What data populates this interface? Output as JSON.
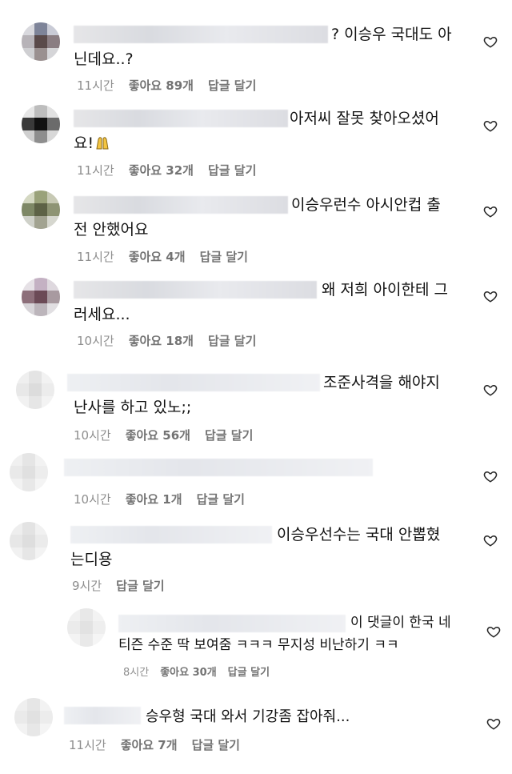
{
  "comments": [
    {
      "text_line1": "? 이승우 국대도 아",
      "text_line2": "닌데요..?",
      "time": "11시간",
      "likes": "좋아요 89개",
      "reply": "답글 달기",
      "avatar_colors": [
        "#d9d9de",
        "#7e8499",
        "#c9cbd6",
        "#b7b3b8",
        "#5a4a4a",
        "#8a7d82",
        "#cfcfd2",
        "#9a9090",
        "#d5d5d8"
      ]
    },
    {
      "text_line1": "아저씨 잘못 찾아오셨어",
      "text_line2": "요!",
      "emoji": "folded-hands",
      "time": "11시간",
      "likes": "좋아요 32개",
      "reply": "답글 달기",
      "avatar_colors": [
        "#e6e6e6",
        "#bdbdbd",
        "#e1e1e1",
        "#3a3a3a",
        "#111111",
        "#6b6b6b",
        "#cfcfcf",
        "#8e8e8e",
        "#d8d8d8"
      ]
    },
    {
      "text_line1": "이승우런수 아시안컵 출",
      "text_line2": "전 안했어요",
      "time": "11시간",
      "likes": "좋아요 4개",
      "reply": "답글 달기",
      "avatar_colors": [
        "#d4d8c2",
        "#9aa27a",
        "#c7c9b4",
        "#7e8866",
        "#5d6246",
        "#8e9474",
        "#cfd1c9",
        "#a2a391",
        "#d6d7cf"
      ]
    },
    {
      "text_line1": "왜 저희 아이한테 그",
      "text_line2": "러세요...",
      "time": "10시간",
      "likes": "좋아요 18개",
      "reply": "답글 달기",
      "avatar_colors": [
        "#e6e1e6",
        "#c4b1c3",
        "#ded8de",
        "#8d6f7a",
        "#6b4a56",
        "#a89aa0",
        "#d7d4d8",
        "#bcb5bb",
        "#e1dfe2"
      ]
    },
    {
      "text_line1": "조준사격을 해야지",
      "text_line2": "난사를 하고 있노;;",
      "time": "10시간",
      "likes": "좋아요 56개",
      "reply": "답글 달기",
      "avatar_colors": [
        "#efefef",
        "#e4e4e4",
        "#f2f2f2",
        "#e8e8e8",
        "#dcdcdc",
        "#ececec",
        "#f1f1f1",
        "#e6e6e6",
        "#f3f3f3"
      ]
    },
    {
      "text_line1": "",
      "time": "10시간",
      "likes": "좋아요 1개",
      "reply": "답글 달기",
      "avatar_colors": [
        "#f0f0f0",
        "#e5e5e5",
        "#f2f2f2",
        "#e9e9e9",
        "#e0e0e0",
        "#ededed",
        "#f2f2f2",
        "#e8e8e8",
        "#f4f4f4"
      ]
    },
    {
      "text_line1": "이승우선수는 국대 안뽑혔",
      "text_line2": "는디용",
      "time": "9시간",
      "reply": "답글 달기",
      "avatar_colors": [
        "#eeeeee",
        "#e3e3e3",
        "#f1f1f1",
        "#e7e7e7",
        "#dedede",
        "#ebebeb",
        "#f1f1f1",
        "#e6e6e6",
        "#f3f3f3"
      ]
    },
    {
      "text_line1": "이 댓글이 한국 네",
      "text_line2": "티즌 수준 딱 보여줌 ㅋㅋㅋ 무지성 비난하기 ㅋㅋ",
      "time": "8시간",
      "likes": "좋아요 30개",
      "reply": "답글 달기",
      "avatar_colors": [
        "#f1f1f1",
        "#e8e8e8",
        "#f3f3f3",
        "#ebebeb",
        "#e2e2e2",
        "#eeeeee",
        "#f3f3f3",
        "#e9e9e9",
        "#f5f5f5"
      ]
    },
    {
      "text_line1": "승우형 국대 와서 기강좀 잡아줘...",
      "time": "11시간",
      "likes": "좋아요 7개",
      "reply": "답글 달기",
      "avatar_colors": [
        "#efefef",
        "#e6e6e6",
        "#f2f2f2",
        "#eaeaea",
        "#e1e1e1",
        "#ececec",
        "#f2f2f2",
        "#e7e7e7",
        "#f4f4f4"
      ]
    }
  ]
}
